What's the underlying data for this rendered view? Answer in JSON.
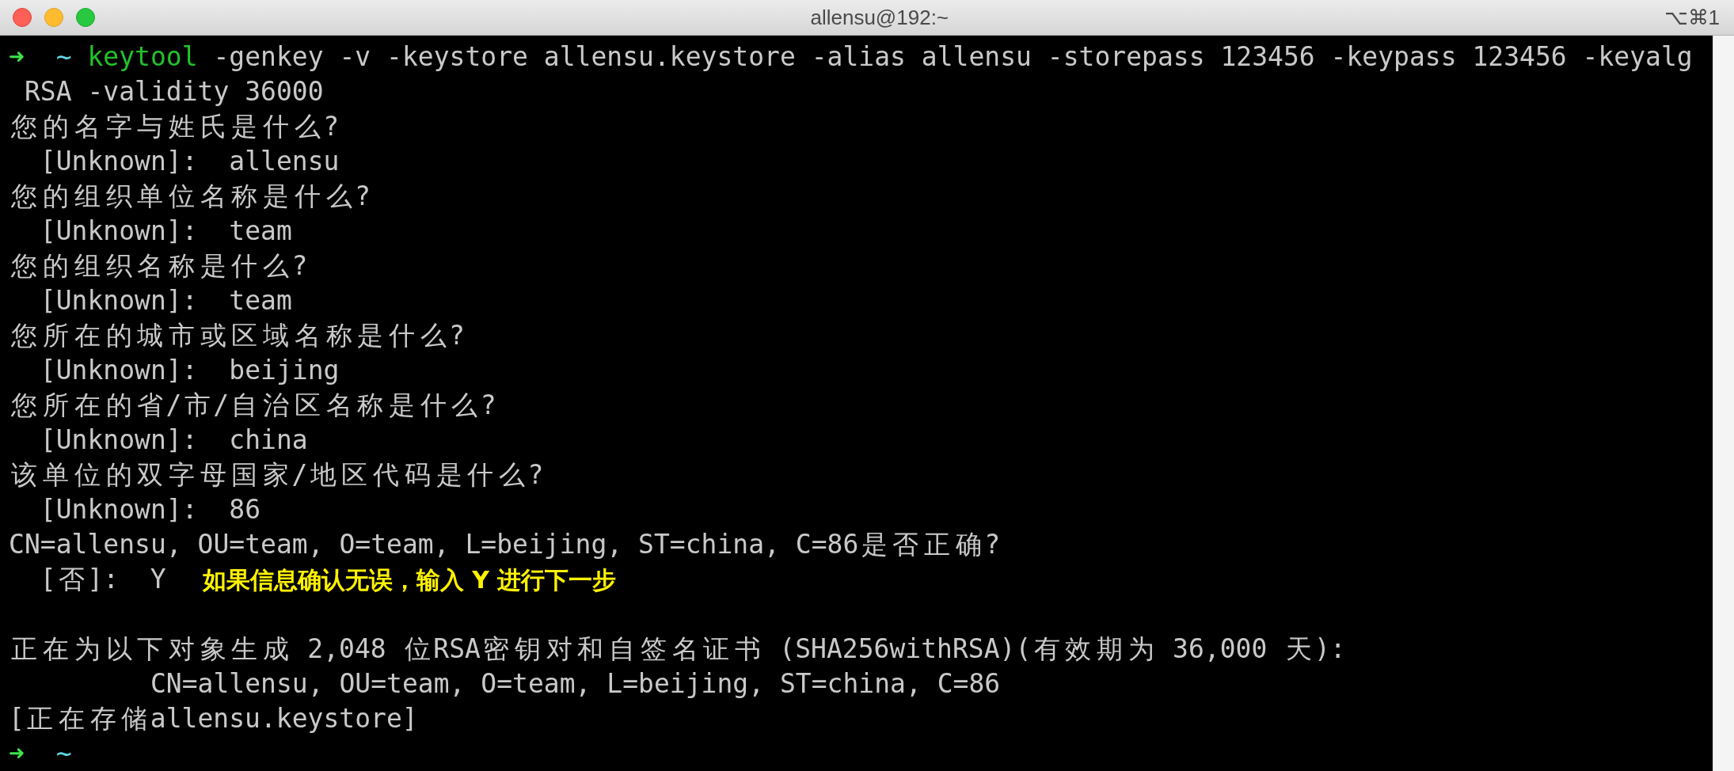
{
  "window": {
    "title": "allensu@192:~",
    "shortcut": "⌥⌘1"
  },
  "lines": [
    {
      "segments": [
        {
          "kind": "prompt",
          "text": "➜"
        },
        {
          "kind": "dir",
          "text": "  ~ "
        },
        {
          "kind": "command",
          "text": "keytool"
        },
        {
          "kind": "output",
          "text": " -genkey -v -keystore allensu.keystore -alias allensu -storepass 123456 -keypass 123456 -keyalg"
        }
      ]
    },
    {
      "segments": [
        {
          "kind": "output",
          "text": " RSA -validity 36000"
        }
      ]
    },
    {
      "segments": [
        {
          "kind": "output",
          "text": "您的名字与姓氏是什么?"
        }
      ]
    },
    {
      "segments": [
        {
          "kind": "output",
          "text": "  [Unknown]:  allensu"
        }
      ]
    },
    {
      "segments": [
        {
          "kind": "output",
          "text": "您的组织单位名称是什么?"
        }
      ]
    },
    {
      "segments": [
        {
          "kind": "output",
          "text": "  [Unknown]:  team"
        }
      ]
    },
    {
      "segments": [
        {
          "kind": "output",
          "text": "您的组织名称是什么?"
        }
      ]
    },
    {
      "segments": [
        {
          "kind": "output",
          "text": "  [Unknown]:  team"
        }
      ]
    },
    {
      "segments": [
        {
          "kind": "output",
          "text": "您所在的城市或区域名称是什么?"
        }
      ]
    },
    {
      "segments": [
        {
          "kind": "output",
          "text": "  [Unknown]:  beijing"
        }
      ]
    },
    {
      "segments": [
        {
          "kind": "output",
          "text": "您所在的省/市/自治区名称是什么?"
        }
      ]
    },
    {
      "segments": [
        {
          "kind": "output",
          "text": "  [Unknown]:  china"
        }
      ]
    },
    {
      "segments": [
        {
          "kind": "output",
          "text": "该单位的双字母国家/地区代码是什么?"
        }
      ]
    },
    {
      "segments": [
        {
          "kind": "output",
          "text": "  [Unknown]:  86"
        }
      ]
    },
    {
      "segments": [
        {
          "kind": "output",
          "text": "CN=allensu, OU=team, O=team, L=beijing, ST=china, C=86是否正确?"
        }
      ]
    },
    {
      "segments": [
        {
          "kind": "output",
          "text": "  [否]:  Y"
        },
        {
          "kind": "annotation",
          "text": "如果信息确认无误，输入 Y 进行下一步"
        }
      ]
    },
    {
      "gap_before": true,
      "segments": [
        {
          "kind": "output",
          "text": "正在为以下对象生成 2,048 位RSA密钥对和自签名证书 (SHA256withRSA)(有效期为 36,000 天):"
        }
      ]
    },
    {
      "segments": [
        {
          "kind": "output",
          "text": "         CN=allensu, OU=team, O=team, L=beijing, ST=china, C=86"
        }
      ]
    },
    {
      "segments": [
        {
          "kind": "output",
          "text": "[正在存储allensu.keystore]"
        }
      ]
    },
    {
      "segments": [
        {
          "kind": "prompt",
          "text": "➜"
        },
        {
          "kind": "dir",
          "text": "  ~"
        }
      ]
    }
  ]
}
